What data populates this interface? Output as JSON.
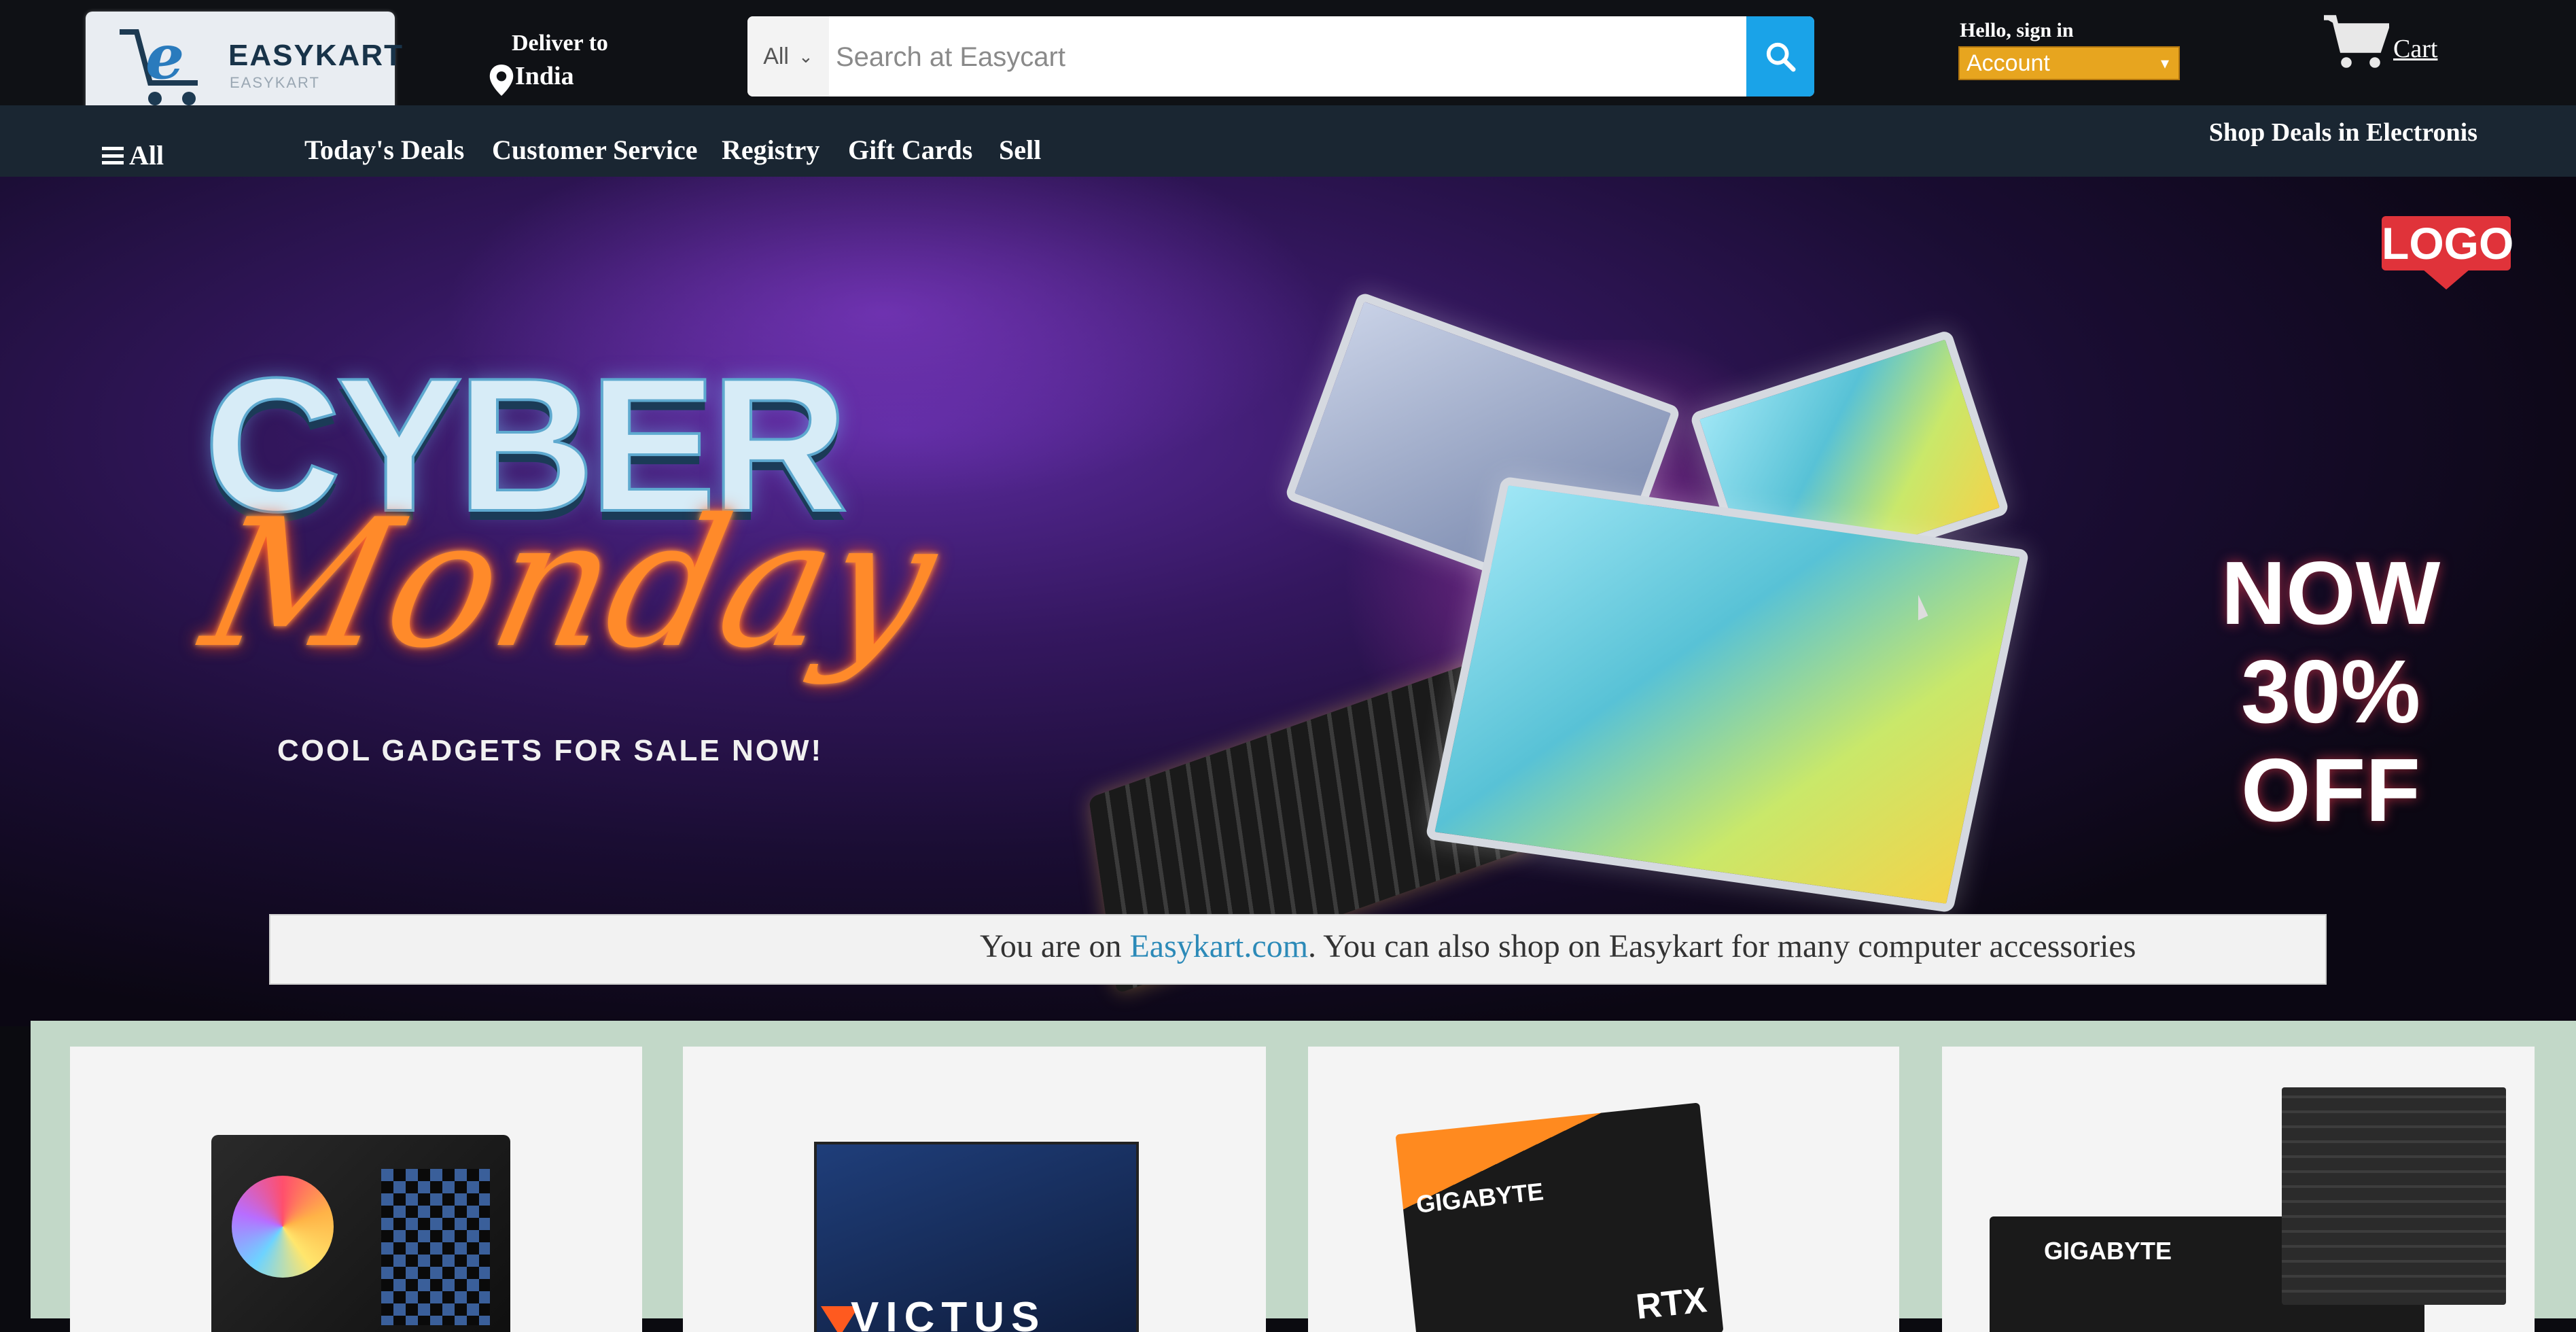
{
  "brand": {
    "name": "EASYKART",
    "sub": "EASYKART"
  },
  "deliver": {
    "label": "Deliver to",
    "location": "India"
  },
  "search": {
    "category": "All",
    "placeholder": "Search at Easycart"
  },
  "account": {
    "greeting": "Hello, sign in",
    "selected": "Account"
  },
  "cart": {
    "label": "Cart"
  },
  "nav": {
    "all_label": "All",
    "items": [
      "Today's Deals",
      "Customer Service",
      "Registry",
      "Gift Cards",
      "Sell"
    ],
    "right_label": "Shop Deals in Electronis"
  },
  "hero": {
    "title_top": "CYBER",
    "title_bottom": "Monday",
    "tagline": "COOL GADGETS FOR SALE NOW!",
    "logo_label": "LOGO",
    "offer_line1": "NOW",
    "offer_line2": "30%",
    "offer_line3": "OFF"
  },
  "marquee": {
    "prefix": "You are on ",
    "link": "Easykart.com",
    "suffix": ". You can also shop on Easykart for many computer accessories"
  },
  "products": {
    "victus_label": "VICTUS",
    "gpu_brand": "GIGABYTE",
    "gpu_model": "RTX",
    "mobo_brand": "GIGABYTE"
  },
  "colors": {
    "topbar": "#0f1115",
    "navbar": "#1a2632",
    "search_button": "#1aa3e8",
    "account_select": "#e7a51f",
    "products_band": "#c2d8c8"
  },
  "icons": [
    "search-icon",
    "map-pin-icon",
    "cart-icon",
    "menu-icon",
    "chevron-down-icon"
  ]
}
